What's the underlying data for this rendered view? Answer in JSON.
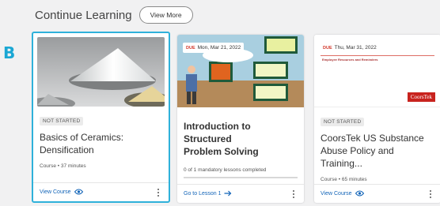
{
  "annotation_label": "B",
  "section": {
    "title": "Continue Learning",
    "view_more_label": "View More"
  },
  "cards": [
    {
      "status": "NOT STARTED",
      "title_line1": "Basics of Ceramics:",
      "title_line2": "Densification",
      "meta": "Course • 37 minutes",
      "action_label": "View Course",
      "action_icon": "eye-icon",
      "selected": true
    },
    {
      "due_tag": "DUE",
      "due_date": "Mon, Mar 21, 2022",
      "title_line1": "Introduction to Structured",
      "title_line2": "Problem Solving",
      "lessons": "0 of 1 mandatory lessons completed",
      "action_label": "Go to Lesson 1",
      "action_icon": "arrow-right-icon"
    },
    {
      "due_tag": "DUE",
      "due_date": "Thu, Mar 31, 2022",
      "slide_header": "Employee Resources and Reminders",
      "brand": "CoorsTek",
      "status": "NOT STARTED",
      "title_line1": "CoorsTek US Substance",
      "title_line2": "Abuse Policy and Training...",
      "meta": "Course • 65 minutes",
      "action_label": "View Course",
      "action_icon": "eye-icon"
    }
  ],
  "colors": {
    "accent_link": "#1264b8",
    "selection_border": "#2fb1da",
    "due_red": "#d2372a",
    "brand_red": "#c8231e"
  }
}
